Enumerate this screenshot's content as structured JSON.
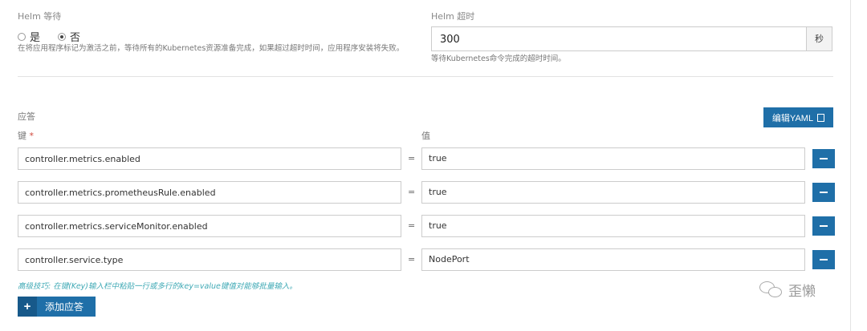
{
  "helm_wait": {
    "label": "Helm 等待",
    "options": [
      "是",
      "否"
    ],
    "selected": "否",
    "help": "在将应用程序标记为激活之前，等待所有的Kubernetes资源准备完成，如果超过超时时间，应用程序安装将失败。"
  },
  "helm_timeout": {
    "label": "Helm 超时",
    "value": "300",
    "unit": "秒",
    "help": "等待Kubernetes命令完成的超时时间。"
  },
  "answers": {
    "title": "应答",
    "edit_yaml_label": "编辑YAML",
    "key_header": "键",
    "required_mark": "*",
    "value_header": "值",
    "equals": "=",
    "rows": [
      {
        "key": "controller.metrics.enabled",
        "value": "true"
      },
      {
        "key": "controller.metrics.prometheusRule.enabled",
        "value": "true"
      },
      {
        "key": "controller.metrics.serviceMonitor.enabled",
        "value": "true"
      },
      {
        "key": "controller.service.type",
        "value": "NodePort"
      }
    ],
    "tip": "高级技巧: 在键(Key)输入栏中粘贴一行或多行的key=value键值对能够批量输入。",
    "add_label": "添加应答",
    "add_icon": "+"
  },
  "watermark": {
    "text": "歪懒"
  },
  "colors": {
    "accent": "#1f6fa8",
    "tip": "#3fa9b5"
  }
}
